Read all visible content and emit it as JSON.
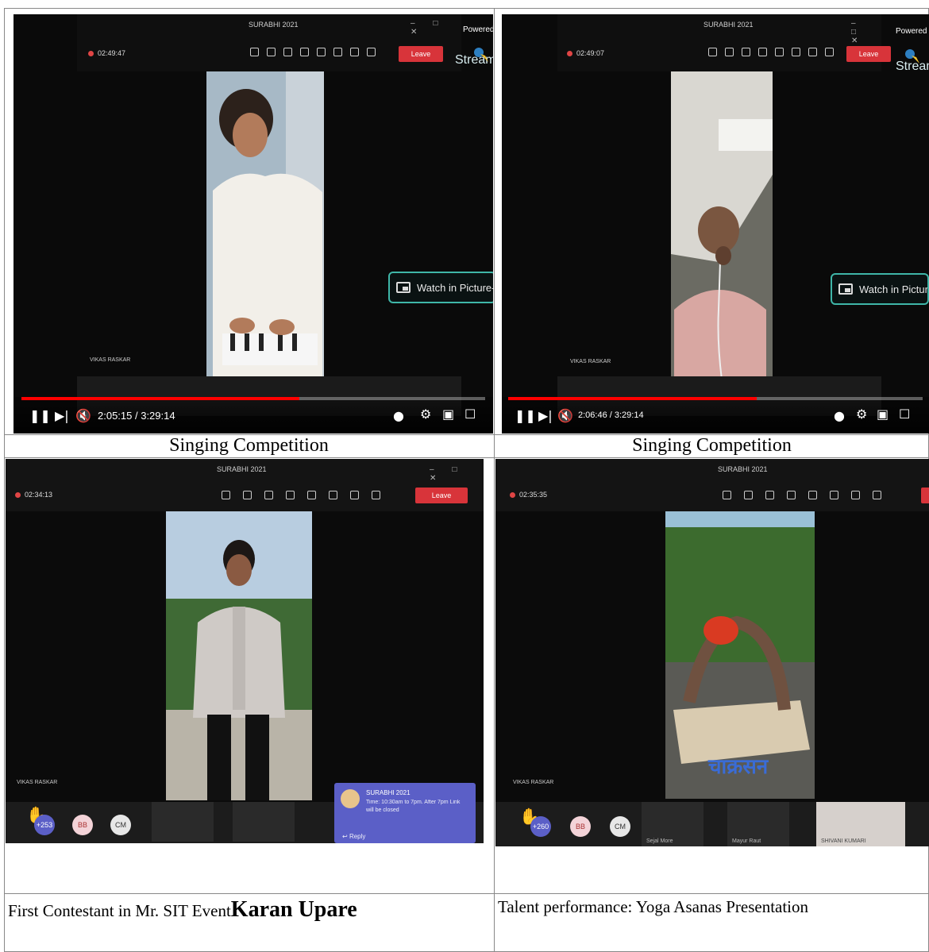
{
  "captions": {
    "top_left": "Singing Competition",
    "top_right": "Singing Competition",
    "bottom_left_lead": "First Contestant in Mr. SIT Event",
    "bottom_left_name": "Karan Upare",
    "bottom_right": "Talent performance: Yoga Asanas Presentation"
  },
  "meeting": {
    "title": "SURABHI 2021",
    "leave_label": "Leave",
    "timers": [
      "02:49:47",
      "02:49:07",
      "02:34:13",
      "02:35:35"
    ],
    "presenter_name": "VIKAS RASKAR"
  },
  "streamyard": {
    "powered_label": "Powered",
    "powered_label_2": "Powered by",
    "brand": "StreamY",
    "brand_2": "StreamYa"
  },
  "pip": {
    "label_1": "Watch in Picture-in-Pic",
    "label_2": "Watch in Picture-in-Pictu"
  },
  "player": {
    "time_1": "2:05:15 / 3:29:14",
    "time_2": "2:06:46 / 3:29:14",
    "progress_1": 0.6,
    "progress_2": 0.6
  },
  "participants": {
    "raised_count_1": "+253",
    "raised_count_2": "+260",
    "avatar_bb": "BB",
    "avatar_cm": "CM",
    "name_1": "Sejal More",
    "name_2": "Mayur Raut",
    "name_3": "SHIVANI KUMARI"
  },
  "chat": {
    "title": "SURABHI 2021",
    "body": "Time: 10:30am to 7pm. After 7pm Link will be closed",
    "reply": "Reply"
  },
  "yoga_overlay": "चाक्रसन",
  "colors": {
    "leave_red": "#d8343a",
    "teams_purple": "#5b5fc7",
    "yt_red": "#ff0000",
    "pip_teal": "#3fb6a8"
  }
}
